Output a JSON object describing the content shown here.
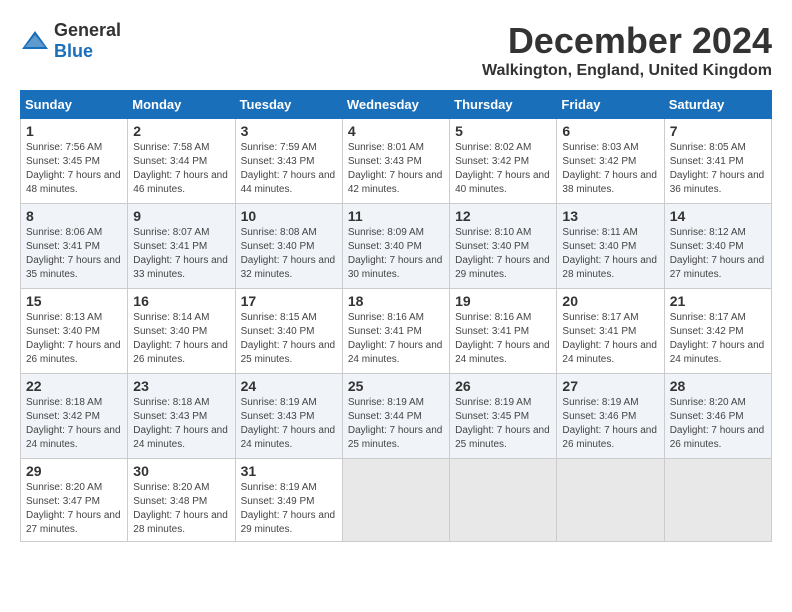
{
  "header": {
    "logo_general": "General",
    "logo_blue": "Blue",
    "month_title": "December 2024",
    "location": "Walkington, England, United Kingdom"
  },
  "days_of_week": [
    "Sunday",
    "Monday",
    "Tuesday",
    "Wednesday",
    "Thursday",
    "Friday",
    "Saturday"
  ],
  "weeks": [
    [
      {
        "day": "1",
        "sunrise": "Sunrise: 7:56 AM",
        "sunset": "Sunset: 3:45 PM",
        "daylight": "Daylight: 7 hours and 48 minutes."
      },
      {
        "day": "2",
        "sunrise": "Sunrise: 7:58 AM",
        "sunset": "Sunset: 3:44 PM",
        "daylight": "Daylight: 7 hours and 46 minutes."
      },
      {
        "day": "3",
        "sunrise": "Sunrise: 7:59 AM",
        "sunset": "Sunset: 3:43 PM",
        "daylight": "Daylight: 7 hours and 44 minutes."
      },
      {
        "day": "4",
        "sunrise": "Sunrise: 8:01 AM",
        "sunset": "Sunset: 3:43 PM",
        "daylight": "Daylight: 7 hours and 42 minutes."
      },
      {
        "day": "5",
        "sunrise": "Sunrise: 8:02 AM",
        "sunset": "Sunset: 3:42 PM",
        "daylight": "Daylight: 7 hours and 40 minutes."
      },
      {
        "day": "6",
        "sunrise": "Sunrise: 8:03 AM",
        "sunset": "Sunset: 3:42 PM",
        "daylight": "Daylight: 7 hours and 38 minutes."
      },
      {
        "day": "7",
        "sunrise": "Sunrise: 8:05 AM",
        "sunset": "Sunset: 3:41 PM",
        "daylight": "Daylight: 7 hours and 36 minutes."
      }
    ],
    [
      {
        "day": "8",
        "sunrise": "Sunrise: 8:06 AM",
        "sunset": "Sunset: 3:41 PM",
        "daylight": "Daylight: 7 hours and 35 minutes."
      },
      {
        "day": "9",
        "sunrise": "Sunrise: 8:07 AM",
        "sunset": "Sunset: 3:41 PM",
        "daylight": "Daylight: 7 hours and 33 minutes."
      },
      {
        "day": "10",
        "sunrise": "Sunrise: 8:08 AM",
        "sunset": "Sunset: 3:40 PM",
        "daylight": "Daylight: 7 hours and 32 minutes."
      },
      {
        "day": "11",
        "sunrise": "Sunrise: 8:09 AM",
        "sunset": "Sunset: 3:40 PM",
        "daylight": "Daylight: 7 hours and 30 minutes."
      },
      {
        "day": "12",
        "sunrise": "Sunrise: 8:10 AM",
        "sunset": "Sunset: 3:40 PM",
        "daylight": "Daylight: 7 hours and 29 minutes."
      },
      {
        "day": "13",
        "sunrise": "Sunrise: 8:11 AM",
        "sunset": "Sunset: 3:40 PM",
        "daylight": "Daylight: 7 hours and 28 minutes."
      },
      {
        "day": "14",
        "sunrise": "Sunrise: 8:12 AM",
        "sunset": "Sunset: 3:40 PM",
        "daylight": "Daylight: 7 hours and 27 minutes."
      }
    ],
    [
      {
        "day": "15",
        "sunrise": "Sunrise: 8:13 AM",
        "sunset": "Sunset: 3:40 PM",
        "daylight": "Daylight: 7 hours and 26 minutes."
      },
      {
        "day": "16",
        "sunrise": "Sunrise: 8:14 AM",
        "sunset": "Sunset: 3:40 PM",
        "daylight": "Daylight: 7 hours and 26 minutes."
      },
      {
        "day": "17",
        "sunrise": "Sunrise: 8:15 AM",
        "sunset": "Sunset: 3:40 PM",
        "daylight": "Daylight: 7 hours and 25 minutes."
      },
      {
        "day": "18",
        "sunrise": "Sunrise: 8:16 AM",
        "sunset": "Sunset: 3:41 PM",
        "daylight": "Daylight: 7 hours and 24 minutes."
      },
      {
        "day": "19",
        "sunrise": "Sunrise: 8:16 AM",
        "sunset": "Sunset: 3:41 PM",
        "daylight": "Daylight: 7 hours and 24 minutes."
      },
      {
        "day": "20",
        "sunrise": "Sunrise: 8:17 AM",
        "sunset": "Sunset: 3:41 PM",
        "daylight": "Daylight: 7 hours and 24 minutes."
      },
      {
        "day": "21",
        "sunrise": "Sunrise: 8:17 AM",
        "sunset": "Sunset: 3:42 PM",
        "daylight": "Daylight: 7 hours and 24 minutes."
      }
    ],
    [
      {
        "day": "22",
        "sunrise": "Sunrise: 8:18 AM",
        "sunset": "Sunset: 3:42 PM",
        "daylight": "Daylight: 7 hours and 24 minutes."
      },
      {
        "day": "23",
        "sunrise": "Sunrise: 8:18 AM",
        "sunset": "Sunset: 3:43 PM",
        "daylight": "Daylight: 7 hours and 24 minutes."
      },
      {
        "day": "24",
        "sunrise": "Sunrise: 8:19 AM",
        "sunset": "Sunset: 3:43 PM",
        "daylight": "Daylight: 7 hours and 24 minutes."
      },
      {
        "day": "25",
        "sunrise": "Sunrise: 8:19 AM",
        "sunset": "Sunset: 3:44 PM",
        "daylight": "Daylight: 7 hours and 25 minutes."
      },
      {
        "day": "26",
        "sunrise": "Sunrise: 8:19 AM",
        "sunset": "Sunset: 3:45 PM",
        "daylight": "Daylight: 7 hours and 25 minutes."
      },
      {
        "day": "27",
        "sunrise": "Sunrise: 8:19 AM",
        "sunset": "Sunset: 3:46 PM",
        "daylight": "Daylight: 7 hours and 26 minutes."
      },
      {
        "day": "28",
        "sunrise": "Sunrise: 8:20 AM",
        "sunset": "Sunset: 3:46 PM",
        "daylight": "Daylight: 7 hours and 26 minutes."
      }
    ],
    [
      {
        "day": "29",
        "sunrise": "Sunrise: 8:20 AM",
        "sunset": "Sunset: 3:47 PM",
        "daylight": "Daylight: 7 hours and 27 minutes."
      },
      {
        "day": "30",
        "sunrise": "Sunrise: 8:20 AM",
        "sunset": "Sunset: 3:48 PM",
        "daylight": "Daylight: 7 hours and 28 minutes."
      },
      {
        "day": "31",
        "sunrise": "Sunrise: 8:19 AM",
        "sunset": "Sunset: 3:49 PM",
        "daylight": "Daylight: 7 hours and 29 minutes."
      },
      null,
      null,
      null,
      null
    ]
  ]
}
